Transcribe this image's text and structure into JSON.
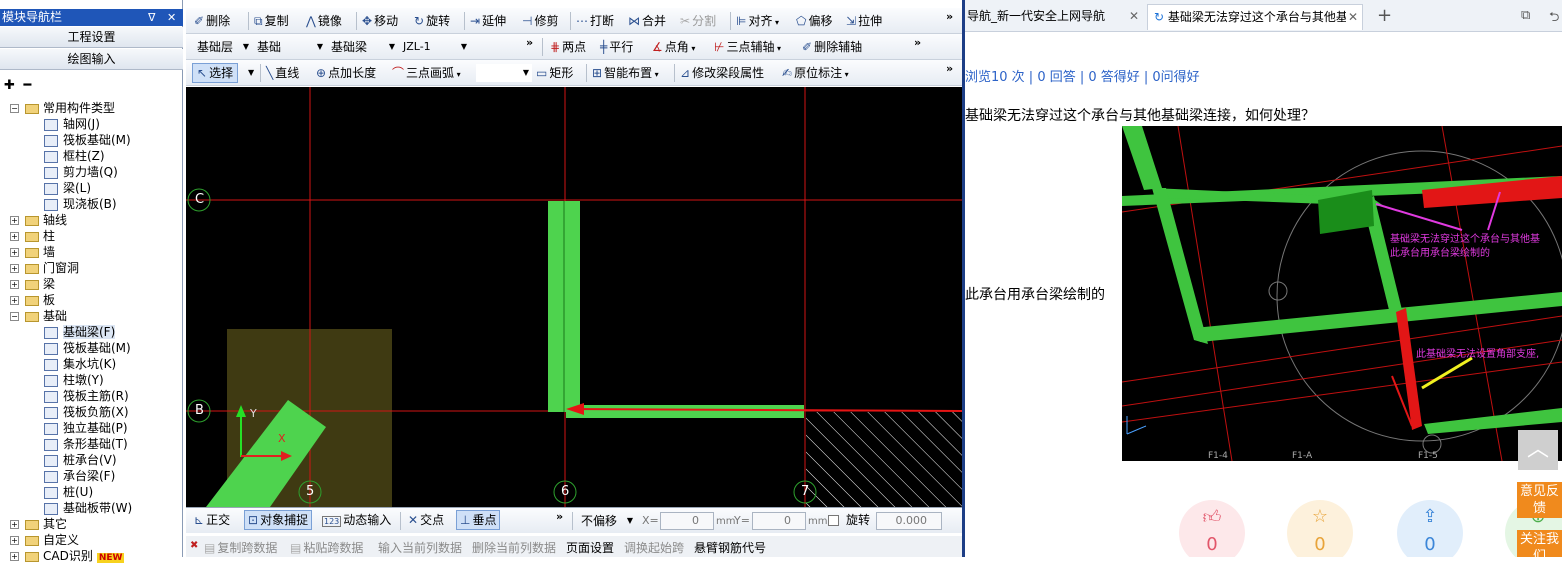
{
  "nav": {
    "title": "模块导航栏",
    "pin_icon": "pin-icon",
    "close_icon": "close-icon",
    "btn_engineering": "工程设置",
    "btn_drawing": "绘图输入",
    "tree": [
      {
        "label": "常用构件类型",
        "level": 0,
        "expander": "−",
        "kind": "folder"
      },
      {
        "label": "轴网(J)",
        "level": 1,
        "kind": "comp"
      },
      {
        "label": "筏板基础(M)",
        "level": 1,
        "kind": "comp"
      },
      {
        "label": "框柱(Z)",
        "level": 1,
        "kind": "comp"
      },
      {
        "label": "剪力墙(Q)",
        "level": 1,
        "kind": "comp"
      },
      {
        "label": "梁(L)",
        "level": 1,
        "kind": "comp"
      },
      {
        "label": "现浇板(B)",
        "level": 1,
        "kind": "comp"
      },
      {
        "label": "轴线",
        "level": 0,
        "expander": "+",
        "kind": "folder"
      },
      {
        "label": "柱",
        "level": 0,
        "expander": "+",
        "kind": "folder"
      },
      {
        "label": "墙",
        "level": 0,
        "expander": "+",
        "kind": "folder"
      },
      {
        "label": "门窗洞",
        "level": 0,
        "expander": "+",
        "kind": "folder"
      },
      {
        "label": "梁",
        "level": 0,
        "expander": "+",
        "kind": "folder"
      },
      {
        "label": "板",
        "level": 0,
        "expander": "+",
        "kind": "folder"
      },
      {
        "label": "基础",
        "level": 0,
        "expander": "−",
        "kind": "folder"
      },
      {
        "label": "基础梁(F)",
        "level": 1,
        "kind": "comp",
        "selected": true
      },
      {
        "label": "筏板基础(M)",
        "level": 1,
        "kind": "comp"
      },
      {
        "label": "集水坑(K)",
        "level": 1,
        "kind": "comp"
      },
      {
        "label": "柱墩(Y)",
        "level": 1,
        "kind": "comp"
      },
      {
        "label": "筏板主筋(R)",
        "level": 1,
        "kind": "comp"
      },
      {
        "label": "筏板负筋(X)",
        "level": 1,
        "kind": "comp"
      },
      {
        "label": "独立基础(P)",
        "level": 1,
        "kind": "comp"
      },
      {
        "label": "条形基础(T)",
        "level": 1,
        "kind": "comp"
      },
      {
        "label": "桩承台(V)",
        "level": 1,
        "kind": "comp"
      },
      {
        "label": "承台梁(F)",
        "level": 1,
        "kind": "comp"
      },
      {
        "label": "桩(U)",
        "level": 1,
        "kind": "comp"
      },
      {
        "label": "基础板带(W)",
        "level": 1,
        "kind": "comp"
      },
      {
        "label": "其它",
        "level": 0,
        "expander": "+",
        "kind": "folder"
      },
      {
        "label": "自定义",
        "level": 0,
        "expander": "+",
        "kind": "folder"
      },
      {
        "label": "CAD识别",
        "level": 0,
        "expander": "+",
        "kind": "folder",
        "badge": "NEW"
      }
    ]
  },
  "toolbar1": {
    "delete": "删除",
    "copy": "复制",
    "mirror": "镜像",
    "move": "移动",
    "rotate": "旋转",
    "extend": "延伸",
    "trim": "修剪",
    "break": "打断",
    "merge": "合并",
    "split": "分割",
    "align": "对齐",
    "offset": "偏移",
    "stretch": "拉伸"
  },
  "toolbar2": {
    "floor": "基础层",
    "category": "基础",
    "type": "基础梁",
    "name": "JZL-1",
    "two_point": "两点",
    "parallel": "平行",
    "point_angle": "点角",
    "three_point_axis": "三点辅轴",
    "delete_axis": "删除辅轴"
  },
  "toolbar3": {
    "select": "选择",
    "line": "直线",
    "point_length": "点加长度",
    "three_point_arc": "三点画弧",
    "rect": "矩形",
    "smart_layout": "智能布置",
    "modify_span": "修改梁段属性",
    "in_place_label": "原位标注"
  },
  "canvas": {
    "axis_c": "C",
    "axis_b": "B",
    "axis_5": "5",
    "axis_6": "6",
    "axis_7": "7",
    "ucs_x": "X",
    "ucs_y": "Y"
  },
  "bottombar": {
    "ortho": "正交",
    "snap": "对象捕捉",
    "dynamic_input": "动态输入",
    "intersection": "交点",
    "perpendicular": "垂点",
    "offset_mode": "不偏移",
    "x_label": "X=",
    "x_value": "0",
    "y_label": "Y=",
    "y_value": "0",
    "unit": "mm",
    "rotate_label": "旋转",
    "rotate_value": "0.000"
  },
  "statusbar": {
    "copy_span": "复制跨数据",
    "paste_span": "粘贴跨数据",
    "input_col": "输入当前列数据",
    "delete_col": "删除当前列数据",
    "page_setup": "页面设置",
    "swap_start": "调换起始跨",
    "cantilever": "悬臂钢筋代号"
  },
  "browser": {
    "tab1": "导航_新一代安全上网导航",
    "tab2": "基础梁无法穿过这个承台与其他基",
    "new_tab": "+",
    "stats": "浏览10 次 | 0 回答 | 0 答得好 | 0问得好",
    "question": "基础梁无法穿过这个承台与其他基础梁连接，如何处理？",
    "answer_text": "此承台用承台梁绘制的",
    "img_note1a": "基础梁无法穿过这个承台与其他基",
    "img_note1b": "此承台用承台梁绘制的",
    "img_note2": "此基础梁无法设置角部支座,",
    "img_axis1": "F1-4",
    "img_axis2": "F1-A",
    "img_axis3": "F1-5",
    "like_count": "0",
    "fav_count": "0",
    "share_count": "0",
    "feedback": "意见反馈",
    "follow": "关注我们"
  }
}
